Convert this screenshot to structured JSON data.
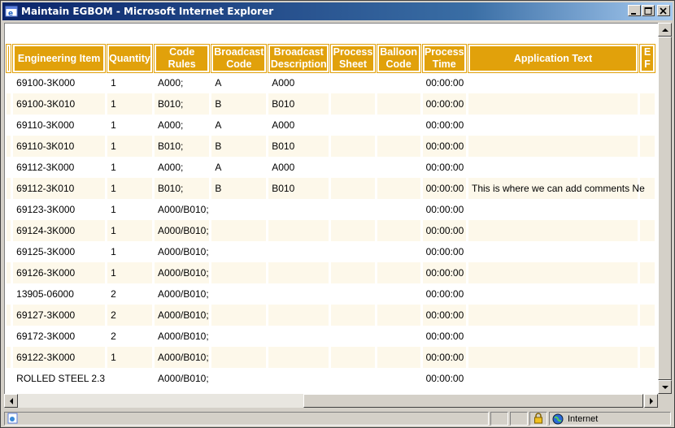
{
  "window": {
    "title": "Maintain EGBOM - Microsoft Internet Explorer"
  },
  "table": {
    "headers": [
      "Engineering Item",
      "Quantity",
      "Code Rules",
      "Broadcast Code",
      "Broadcast Description",
      "Process Sheet",
      "Balloon Code",
      "Process Time",
      "Application Text",
      "E F"
    ],
    "rows": [
      {
        "item": "69100-3K000",
        "qty": "1",
        "rules": "A000;",
        "bcode": "A",
        "bdesc": "A000",
        "sheet": "",
        "balloon": "",
        "time": "00:00:00",
        "app": ""
      },
      {
        "item": "69100-3K010",
        "qty": "1",
        "rules": "B010;",
        "bcode": "B",
        "bdesc": "B010",
        "sheet": "",
        "balloon": "",
        "time": "00:00:00",
        "app": ""
      },
      {
        "item": "69110-3K000",
        "qty": "1",
        "rules": "A000;",
        "bcode": "A",
        "bdesc": "A000",
        "sheet": "",
        "balloon": "",
        "time": "00:00:00",
        "app": ""
      },
      {
        "item": "69110-3K010",
        "qty": "1",
        "rules": "B010;",
        "bcode": "B",
        "bdesc": "B010",
        "sheet": "",
        "balloon": "",
        "time": "00:00:00",
        "app": ""
      },
      {
        "item": "69112-3K000",
        "qty": "1",
        "rules": "A000;",
        "bcode": "A",
        "bdesc": "A000",
        "sheet": "",
        "balloon": "",
        "time": "00:00:00",
        "app": ""
      },
      {
        "item": "69112-3K010",
        "qty": "1",
        "rules": "B010;",
        "bcode": "B",
        "bdesc": "B010",
        "sheet": "",
        "balloon": "",
        "time": "00:00:00",
        "app": "This is where we can add comments Ne"
      },
      {
        "item": "69123-3K000",
        "qty": "1",
        "rules": "A000/B010;",
        "bcode": "",
        "bdesc": "",
        "sheet": "",
        "balloon": "",
        "time": "00:00:00",
        "app": ""
      },
      {
        "item": "69124-3K000",
        "qty": "1",
        "rules": "A000/B010;",
        "bcode": "",
        "bdesc": "",
        "sheet": "",
        "balloon": "",
        "time": "00:00:00",
        "app": ""
      },
      {
        "item": "69125-3K000",
        "qty": "1",
        "rules": "A000/B010;",
        "bcode": "",
        "bdesc": "",
        "sheet": "",
        "balloon": "",
        "time": "00:00:00",
        "app": ""
      },
      {
        "item": "69126-3K000",
        "qty": "1",
        "rules": "A000/B010;",
        "bcode": "",
        "bdesc": "",
        "sheet": "",
        "balloon": "",
        "time": "00:00:00",
        "app": ""
      },
      {
        "item": "13905-06000",
        "qty": "2",
        "rules": "A000/B010;",
        "bcode": "",
        "bdesc": "",
        "sheet": "",
        "balloon": "",
        "time": "00:00:00",
        "app": ""
      },
      {
        "item": "69127-3K000",
        "qty": "2",
        "rules": "A000/B010;",
        "bcode": "",
        "bdesc": "",
        "sheet": "",
        "balloon": "",
        "time": "00:00:00",
        "app": ""
      },
      {
        "item": "69172-3K000",
        "qty": "2",
        "rules": "A000/B010;",
        "bcode": "",
        "bdesc": "",
        "sheet": "",
        "balloon": "",
        "time": "00:00:00",
        "app": ""
      },
      {
        "item": "69122-3K000",
        "qty": "1",
        "rules": "A000/B010;",
        "bcode": "",
        "bdesc": "",
        "sheet": "",
        "balloon": "",
        "time": "00:00:00",
        "app": ""
      },
      {
        "item": "ROLLED STEEL 2.3",
        "qty": "",
        "rules": "A000/B010;",
        "bcode": "",
        "bdesc": "",
        "sheet": "",
        "balloon": "",
        "time": "00:00:00",
        "app": ""
      }
    ]
  },
  "status": {
    "zone": "Internet"
  },
  "colors": {
    "header_bg": "#e1a10b",
    "row_alt": "#fdf8ea",
    "title_start": "#0a246a"
  },
  "icons": {
    "title": "ie-logo-icon",
    "lock": "lock-icon",
    "zone": "globe-icon"
  }
}
